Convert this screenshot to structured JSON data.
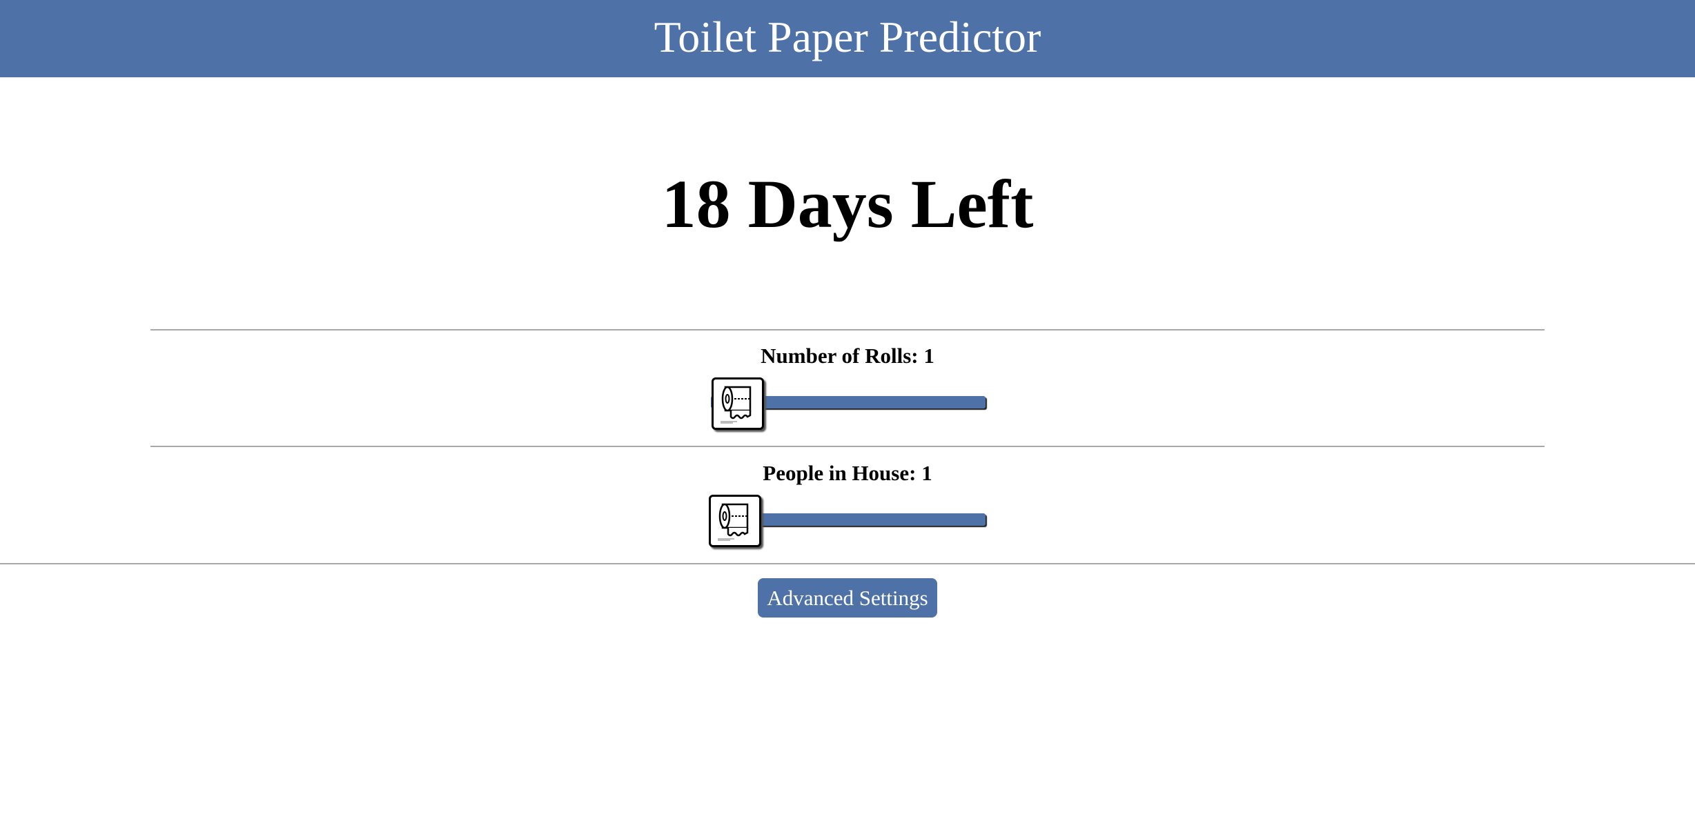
{
  "header": {
    "title": "Toilet Paper Predictor",
    "background_color": "#4e72a8"
  },
  "result": {
    "days_left_text": "18 Days Left"
  },
  "rolls": {
    "label": "Number of Rolls: 1",
    "value": 1,
    "thumb_icon": "toilet-paper-roll-icon"
  },
  "people": {
    "label": "People in House: 1",
    "value": 1,
    "thumb_icon": "toilet-paper-roll-icon"
  },
  "advanced": {
    "button_label": "Advanced Settings"
  },
  "colors": {
    "accent": "#4e72a8",
    "divider": "#a8a8a8",
    "text": "#000000",
    "background": "#ffffff"
  }
}
